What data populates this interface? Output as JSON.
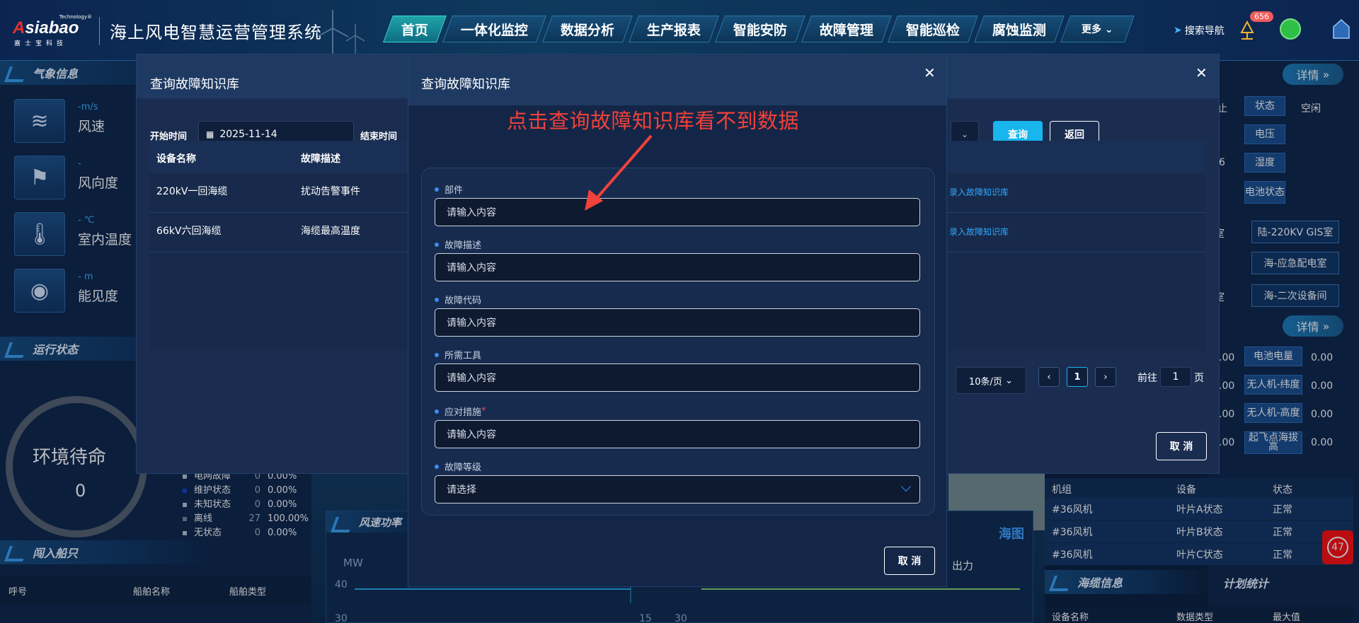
{
  "header": {
    "logo": {
      "tech": "Technology®",
      "brand_a": "A",
      "brand_rest": "siabao",
      "sub": "嘉士宝科技"
    },
    "title": "海上风电智慧运营管理系统",
    "nav": [
      "首页",
      "一体化监控",
      "数据分析",
      "生产报表",
      "智能安防",
      "故障管理",
      "智能巡检",
      "腐蚀监测",
      "更多"
    ],
    "search_nav": "搜索导航",
    "alarm_count": "656"
  },
  "left": {
    "weather_title": "气象信息",
    "weather": [
      {
        "unit": "-m/s",
        "name": "风速",
        "icon": "wind-icon"
      },
      {
        "unit": "-",
        "name": "风向度",
        "icon": "wind-vane-icon"
      },
      {
        "unit": "- ℃",
        "name": "室内温度",
        "icon": "thermometer-icon"
      },
      {
        "unit": "- m",
        "name": "能见度",
        "icon": "eye-icon"
      }
    ],
    "status_title": "运行状态",
    "gauge_text": "环境待命",
    "gauge_value": "0",
    "legend": [
      {
        "label": "电网故障",
        "count": "0",
        "pct": "0.00%"
      },
      {
        "label": "维护状态",
        "count": "0",
        "pct": "0.00%"
      },
      {
        "label": "未知状态",
        "count": "0",
        "pct": "0.00%"
      },
      {
        "label": "离线",
        "count": "27",
        "pct": "100.00%"
      },
      {
        "label": "无状态",
        "count": "0",
        "pct": "0.00%"
      }
    ],
    "ships_title": "闯入船只",
    "ship_cols": [
      "呼号",
      "船舶名称",
      "船舶类型"
    ]
  },
  "right": {
    "detail": "详情",
    "kv_top": [
      {
        "label": "状态",
        "value": "空闲",
        "pre": "止"
      },
      {
        "label": "电压",
        "value": "",
        "pre": ""
      },
      {
        "label": "湿度",
        "value": "",
        "pre": "6"
      },
      {
        "label": "电池状态",
        "value": "",
        "pre": ""
      }
    ],
    "locations": [
      "陆-220KV GIS室",
      "海-应急配电室",
      "海-二次设备间"
    ],
    "loc_pre": [
      "室",
      "",
      "室"
    ],
    "kv_bottom": [
      {
        "label": "电池电量",
        "value": "0.00",
        "pre": ".00"
      },
      {
        "label": "无人机-纬度",
        "value": "0.00",
        "pre": ".00"
      },
      {
        "label": "无人机-高度",
        "value": "0.00",
        "pre": ".00"
      },
      {
        "label": "起飞点海拔高",
        "value": "0.00",
        "pre": ".00"
      }
    ],
    "table_cols": [
      "机组",
      "设备",
      "状态"
    ],
    "table_rows": [
      [
        "#36风机",
        "叶片A状态",
        "正常"
      ],
      [
        "#36风机",
        "叶片B状态",
        "正常"
      ],
      [
        "#36风机",
        "叶片C状态",
        "正常"
      ]
    ],
    "cable_title": "海缆信息",
    "plan_title": "计划统计",
    "cable_cols": [
      "设备名称",
      "数据类型",
      "最大值"
    ],
    "float_badge": "47"
  },
  "center_bg": {
    "chart_title": "风速功率",
    "unit": "MW",
    "y_ticks": [
      "40",
      "30"
    ],
    "y2_tick": "15",
    "y3_tick": "30",
    "output_label": "出力",
    "sea_label": "海图"
  },
  "outer_modal": {
    "title": "查询故障知识库",
    "start_label": "开始时间",
    "start_value": "2025-11-14",
    "end_label": "结束时间",
    "query_btn": "查询",
    "back_btn": "返回",
    "columns": [
      "设备名称",
      "故障描述"
    ],
    "rows": [
      {
        "device": "220kV一回海缆",
        "desc": "扰动告警事件",
        "action": "录入故障知识库"
      },
      {
        "device": "66kV六回海缆",
        "desc": "海缆最高温度",
        "action": "录入故障知识库"
      }
    ],
    "page_size": "10条/页",
    "current_page": "1",
    "goto_prefix": "前往",
    "goto_value": "1",
    "goto_suffix": "页",
    "cancel_btn": "取 消"
  },
  "inner_modal": {
    "title": "查询故障知识库",
    "fields": [
      {
        "label": "部件",
        "placeholder": "请输入内容",
        "required": false
      },
      {
        "label": "故障描述",
        "placeholder": "请输入内容",
        "required": false
      },
      {
        "label": "故障代码",
        "placeholder": "请输入内容",
        "required": false
      },
      {
        "label": "所需工具",
        "placeholder": "请输入内容",
        "required": false
      },
      {
        "label": "应对措施",
        "placeholder": "请输入内容",
        "required": true
      },
      {
        "label": "故障等级",
        "placeholder": "请选择",
        "required": false
      }
    ],
    "cancel_btn": "取 消"
  },
  "annotation": "点击查询故障知识库看不到数据"
}
